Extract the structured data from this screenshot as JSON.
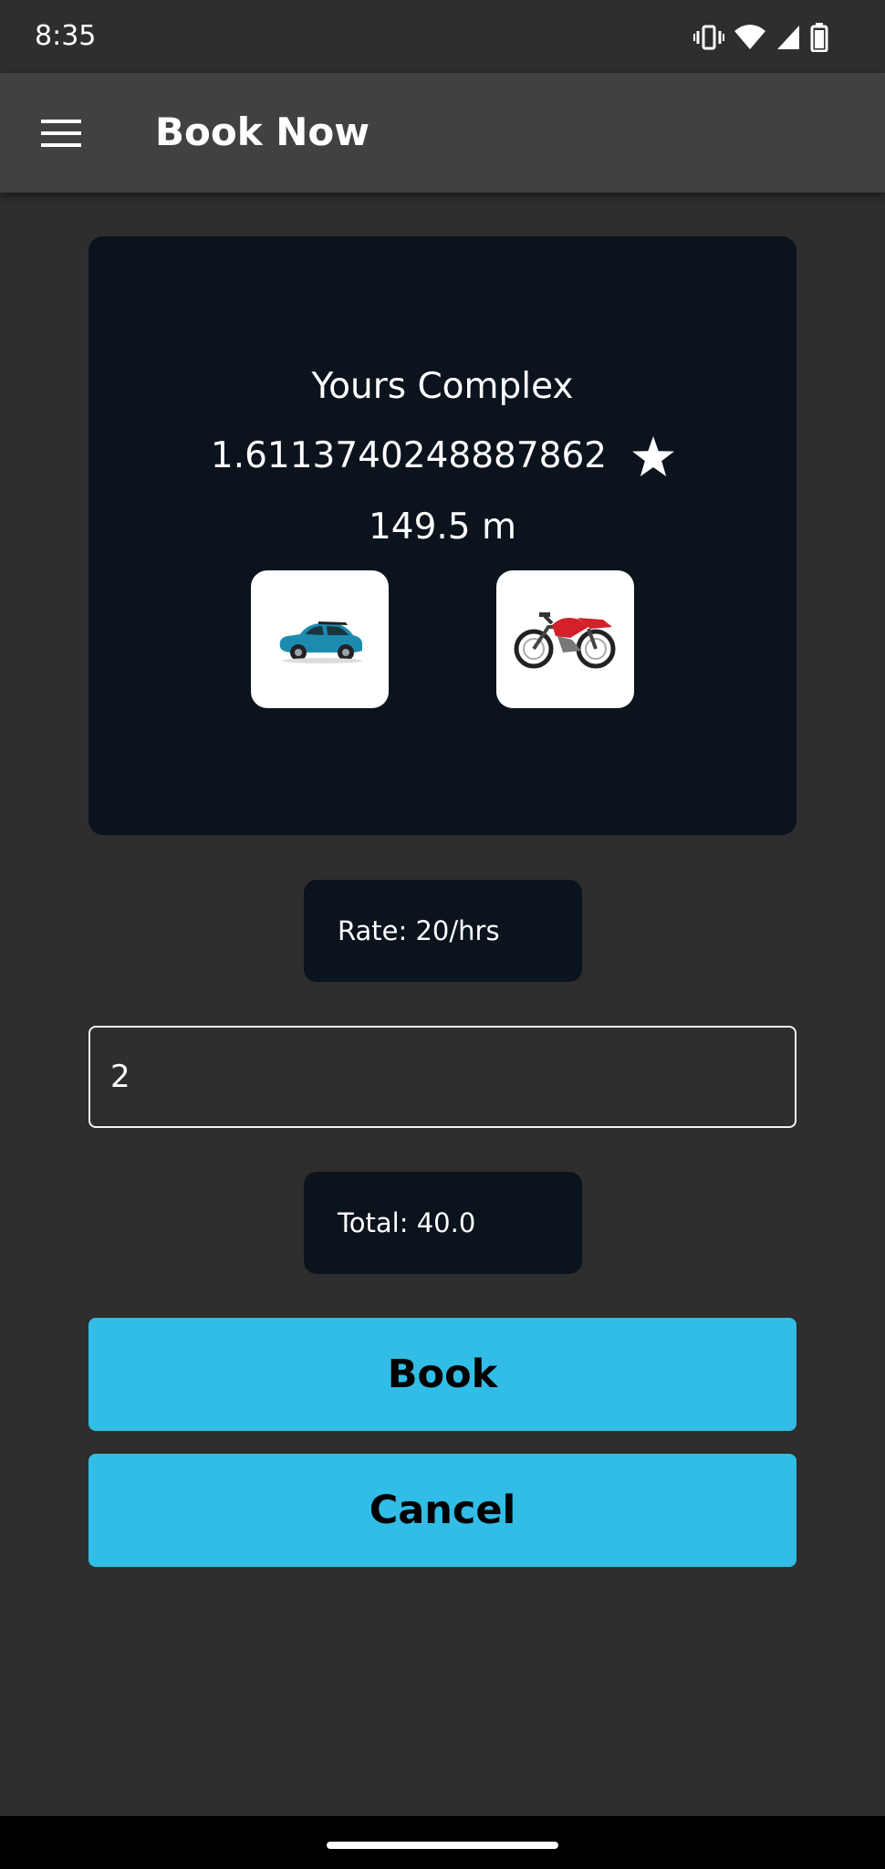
{
  "status_bar": {
    "time": "8:35",
    "icons": [
      "vibrate-icon",
      "wifi-icon",
      "signal-icon",
      "battery-icon"
    ]
  },
  "app_bar": {
    "title": "Book Now",
    "menu_icon": "hamburger-menu-icon"
  },
  "location_card": {
    "name": "Yours Complex",
    "rating": "1.6113740248887862",
    "rating_icon": "star-icon",
    "distance": "149.5 m",
    "vehicle_options": [
      {
        "icon": "car-icon"
      },
      {
        "icon": "motorcycle-icon"
      }
    ]
  },
  "rate": {
    "text": "Rate: 20/hrs"
  },
  "hours_input": {
    "value": "2"
  },
  "total": {
    "text": "Total: 40.0"
  },
  "actions": {
    "book_label": "Book",
    "cancel_label": "Cancel"
  },
  "colors": {
    "background": "#2e2e2e",
    "app_bar": "#414141",
    "card": "#0b131d",
    "accent": "#31bde6"
  }
}
